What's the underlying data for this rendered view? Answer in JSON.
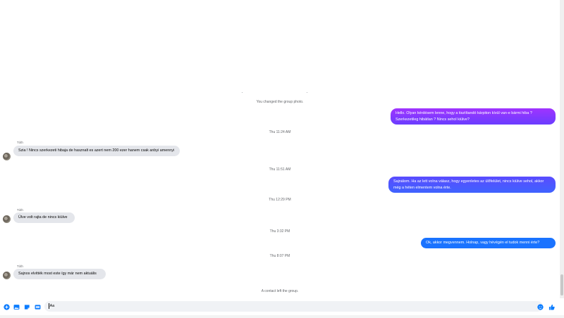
{
  "colors": {
    "accent": "#0a7cff",
    "bubble_out_top": "#a033ff",
    "bubble_out_mid": "#5b47ff",
    "bubble_out_bottom": "#1a73ff",
    "bubble_in": "#e4e6eb"
  },
  "messages": {
    "sys_group_photo": "You changed the group photo.",
    "out_1": "Hello. Olyan kérdésem lenne, hogy a tisztítandó kárpiton kívül van-e bármi hiba ? Szerkezetileg hibátlan ? Nincs sehol kiülve?",
    "ts_1": "Thu 11:24 AM",
    "sender_1": "Tóth",
    "in_1": "Szia ! Nincs szerkezeti hibaja de hasznalt es azert nem 200 ezer hanem csak anbyi amennyi",
    "ts_2": "Thu 11:51 AM",
    "out_2": "Sajnálom. Ha az lett volna válasz, hogy egyenletes az ülőfelület, nincs kiülve sehol, akkor még a héten elmentem volna érte.",
    "ts_3": "Thu 12:29 PM",
    "sender_2": "Tóth",
    "in_2": "Ülve volt rajta de nincs kiülve",
    "ts_4": "Thu 3:32 PM",
    "out_3": "Ok, akkor megvennem. Holnap, vagy hévégén el tudok menni érte?",
    "ts_5": "Thu 8:07 PM",
    "sender_3": "Tóth",
    "in_3": "Sajnos elvitték most este így már nem aktuális",
    "sys_left": "A contact left the group."
  },
  "composer": {
    "value": "Aa",
    "icons": [
      "plus-circle-icon",
      "image-icon",
      "sticker-icon",
      "gif-icon",
      "emoji-icon",
      "like-icon"
    ]
  }
}
